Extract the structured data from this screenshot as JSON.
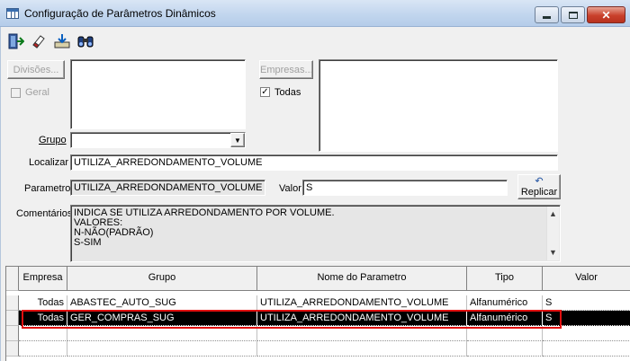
{
  "window": {
    "title": "Configuração de Parâmetros Dinâmicos",
    "close_glyph": "✕"
  },
  "toolbar": {
    "icons": [
      "exit-door-icon",
      "eraser-icon",
      "save-tray-icon",
      "binoculars-icon"
    ]
  },
  "filters": {
    "divisoes_button": "Divisões...",
    "geral_label": "Geral",
    "geral_checked": false,
    "empresas_button": "Empresas...",
    "todas_label": "Todas",
    "todas_checked": true,
    "grupo_label": "Grupo",
    "grupo_value": "",
    "localizar_label": "Localizar",
    "localizar_value": "UTILIZA_ARREDONDAMENTO_VOLUME",
    "parametro_label": "Parametro",
    "parametro_value": "UTILIZA_ARREDONDAMENTO_VOLUME",
    "valor_label": "Valor",
    "valor_value": "S",
    "replicar_button": "Replicar",
    "comentarios_label": "Comentários",
    "comentarios_lines": [
      "INDICA SE UTILIZA ARREDONDAMENTO POR VOLUME.",
      "VALORES:",
      "N-NÃO(PADRÃO)",
      "S-SIM"
    ]
  },
  "grid": {
    "columns": [
      "Empresa",
      "Grupo",
      "Nome do Parametro",
      "Tipo",
      "Valor"
    ],
    "rows": [
      {
        "empresa": "Todas",
        "grupo": "ABASTEC_AUTO_SUG",
        "nome": "UTILIZA_ARREDONDAMENTO_VOLUME",
        "tipo": "Alfanumérico",
        "valor": "S",
        "selected": false
      },
      {
        "empresa": "Todas",
        "grupo": "GER_COMPRAS_SUG",
        "nome": "UTILIZA_ARREDONDAMENTO_VOLUME",
        "tipo": "Alfanumérico",
        "valor": "S",
        "selected": true
      }
    ]
  },
  "colors": {
    "selection_background": "#000000",
    "highlight_border": "#e01010",
    "close_button": "#c9402b"
  }
}
